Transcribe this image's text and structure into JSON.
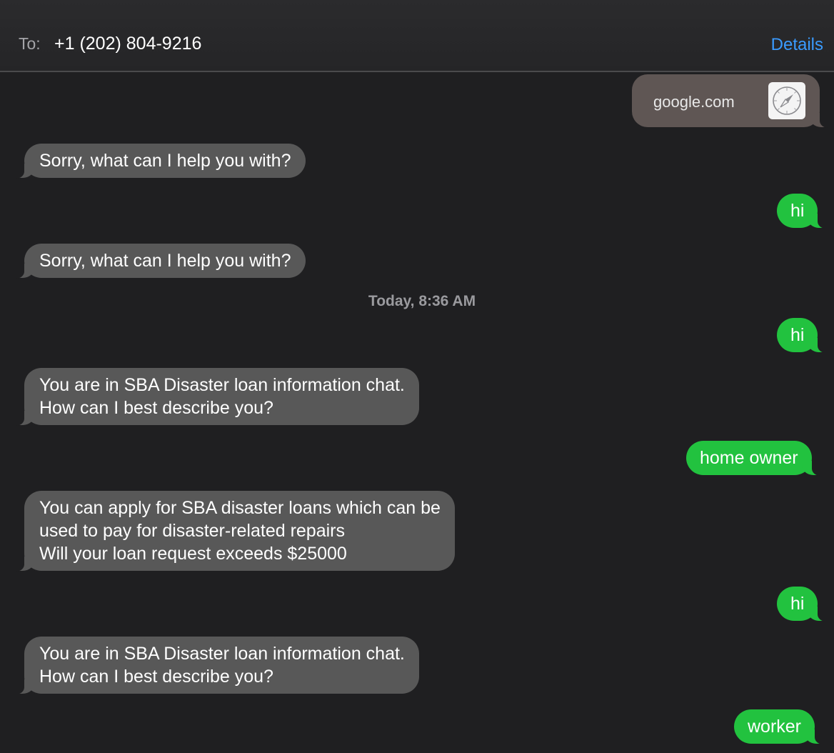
{
  "header": {
    "to_label": "To:",
    "recipient": "+1 (202) 804-9216",
    "details_label": "Details"
  },
  "link_preview": {
    "url": "google.com",
    "icon": "safari-compass-icon"
  },
  "timestamp": "Today, 8:36 AM",
  "messages": [
    {
      "direction": "incoming",
      "text": "Sorry, what can I help you with?"
    },
    {
      "direction": "outgoing",
      "text": "hi"
    },
    {
      "direction": "incoming",
      "text": "Sorry, what can I help you with?"
    },
    {
      "direction": "outgoing",
      "text": "hi"
    },
    {
      "direction": "incoming",
      "text": "You are in SBA Disaster loan information chat.\nHow can I best describe you?"
    },
    {
      "direction": "outgoing",
      "text": "home owner"
    },
    {
      "direction": "incoming",
      "text": "You can apply for SBA disaster loans which can be\nused to pay for disaster-related repairs\nWill your loan request exceeds $25000"
    },
    {
      "direction": "outgoing",
      "text": "hi"
    },
    {
      "direction": "incoming",
      "text": "You are in SBA Disaster loan information chat.\nHow can I best describe you?"
    },
    {
      "direction": "outgoing",
      "text": "worker"
    }
  ],
  "colors": {
    "background": "#1f1f21",
    "incoming_bubble": "#585858",
    "outgoing_bubble": "#22c23f",
    "link_bubble": "#5f5654",
    "accent": "#3a9bff"
  }
}
